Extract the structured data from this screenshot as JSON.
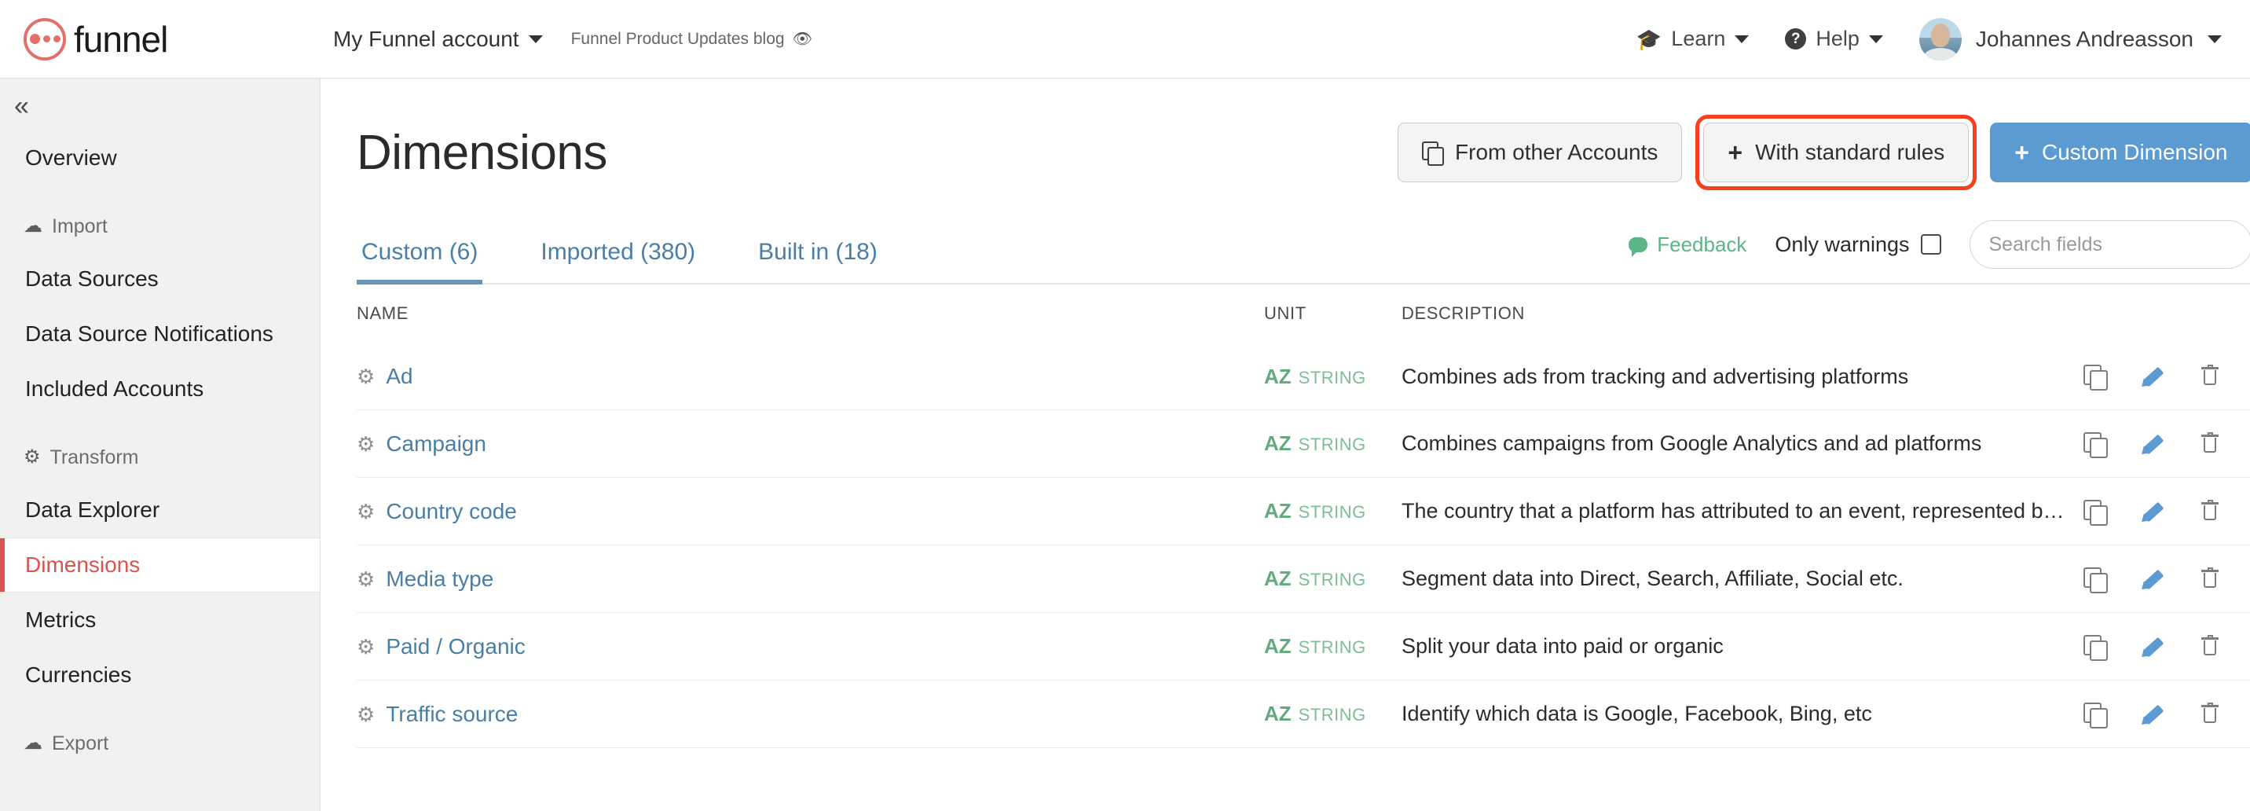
{
  "topbar": {
    "logo_text": "funnel",
    "account_name": "My Funnel account",
    "workspace_name": "Funnel Product Updates blog",
    "learn_label": "Learn",
    "help_label": "Help",
    "help_glyph": "?",
    "user_name": "Johannes Andreasson"
  },
  "sidebar": {
    "collapse_glyph": "«",
    "overview_label": "Overview",
    "groups": [
      {
        "label": "Import",
        "icon": "☁",
        "items": [
          "Data Sources",
          "Data Source Notifications",
          "Included Accounts"
        ]
      },
      {
        "label": "Transform",
        "icon": "⚙",
        "items": [
          "Data Explorer",
          "Dimensions",
          "Metrics",
          "Currencies"
        ]
      },
      {
        "label": "Export",
        "icon": "☁",
        "items": []
      }
    ],
    "active_item": "Dimensions"
  },
  "page": {
    "title": "Dimensions",
    "buttons": {
      "from_other_accounts": "From other Accounts",
      "with_standard_rules": "With standard rules",
      "custom_dimension": "Custom Dimension",
      "plus": "+"
    },
    "highlight_color": "#f4421f",
    "primary_color": "#5b9bd1"
  },
  "tabs": [
    {
      "label": "Custom (6)",
      "active": true
    },
    {
      "label": "Imported (380)",
      "active": false
    },
    {
      "label": "Built in (18)",
      "active": false
    }
  ],
  "toolbar": {
    "feedback_label": "Feedback",
    "only_warnings_label": "Only warnings",
    "only_warnings_checked": false,
    "search_placeholder": "Search fields",
    "search_value": ""
  },
  "table": {
    "headers": {
      "name": "NAME",
      "unit": "UNIT",
      "description": "DESCRIPTION"
    },
    "rows": [
      {
        "name": "Ad",
        "unit_code": "AZ",
        "unit_type": "STRING",
        "description": "Combines ads from tracking and advertising platforms"
      },
      {
        "name": "Campaign",
        "unit_code": "AZ",
        "unit_type": "STRING",
        "description": "Combines campaigns from Google Analytics and ad platforms"
      },
      {
        "name": "Country code",
        "unit_code": "AZ",
        "unit_type": "STRING",
        "description": "The country that a platform has attributed to an event, represented b…"
      },
      {
        "name": "Media type",
        "unit_code": "AZ",
        "unit_type": "STRING",
        "description": "Segment data into Direct, Search, Affiliate, Social etc."
      },
      {
        "name": "Paid / Organic",
        "unit_code": "AZ",
        "unit_type": "STRING",
        "description": "Split your data into paid or organic"
      },
      {
        "name": "Traffic source",
        "unit_code": "AZ",
        "unit_type": "STRING",
        "description": "Identify which data is Google, Facebook, Bing, etc"
      }
    ],
    "row_actions": {
      "copy": "copy-icon",
      "edit": "pencil-icon",
      "delete": "trash-icon"
    }
  }
}
